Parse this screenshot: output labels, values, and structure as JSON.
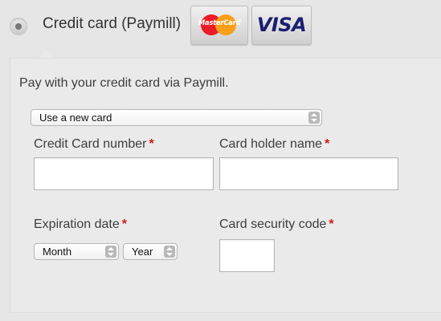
{
  "payment_method": {
    "label": "Credit card (Paymill)",
    "selected": true,
    "logos": {
      "mastercard": "MasterCard",
      "visa": "VISA"
    }
  },
  "form": {
    "description": "Pay with your credit card via Paymill.",
    "card_select": {
      "value": "Use a new card"
    },
    "credit_card_number": {
      "label": "Credit Card number",
      "required_mark": "*",
      "value": ""
    },
    "card_holder_name": {
      "label": "Card holder name",
      "required_mark": "*",
      "value": ""
    },
    "expiration_date": {
      "label": "Expiration date",
      "required_mark": "*",
      "month_value": "Month",
      "year_value": "Year"
    },
    "card_security_code": {
      "label": "Card security code",
      "required_mark": "*",
      "value": ""
    }
  },
  "colors": {
    "background": "#e6e6e6",
    "panel": "#eaeaea",
    "required": "#d81717",
    "mastercard_red": "#eb1c26",
    "mastercard_yellow": "#f99f1b",
    "visa_blue": "#1a1f71"
  }
}
